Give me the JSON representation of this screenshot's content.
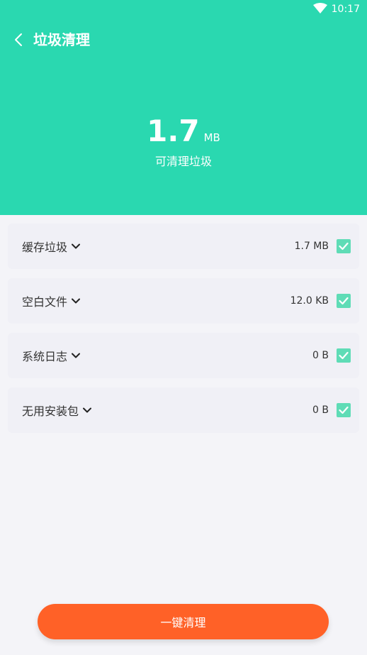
{
  "status_bar": {
    "time": "10:17",
    "wifi_icon": "wifi-icon"
  },
  "header": {
    "back_icon": "back-arrow-icon",
    "title": "垃圾清理",
    "background_color": "#2ad8b0"
  },
  "summary": {
    "size_value": "1.7",
    "size_unit": "MB",
    "label": "可清理垃圾"
  },
  "items": [
    {
      "label": "缓存垃圾",
      "size": "1.7 MB",
      "checked": true
    },
    {
      "label": "空白文件",
      "size": "12.0 KB",
      "checked": true
    },
    {
      "label": "系统日志",
      "size": "0 B",
      "checked": true
    },
    {
      "label": "无用安装包",
      "size": "0 B",
      "checked": true
    }
  ],
  "clean_button": {
    "label": "一键清理",
    "color": "#ff6127"
  }
}
